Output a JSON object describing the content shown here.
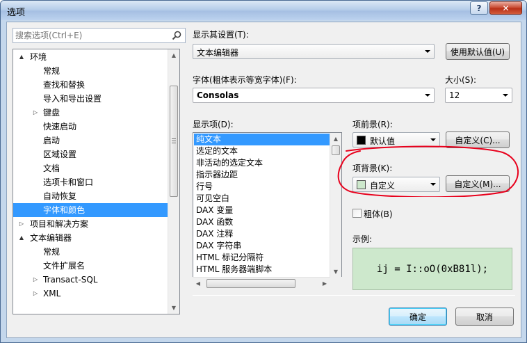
{
  "window": {
    "title": "选项",
    "help_label": "?",
    "close_label": "✕"
  },
  "search": {
    "placeholder": "搜索选项(Ctrl+E)",
    "icon": "search-icon"
  },
  "tree": {
    "items": [
      {
        "label": "环境",
        "arrow": "▲",
        "level": 0
      },
      {
        "label": "常规",
        "arrow": "",
        "level": 1
      },
      {
        "label": "查找和替换",
        "arrow": "",
        "level": 1
      },
      {
        "label": "导入和导出设置",
        "arrow": "",
        "level": 1
      },
      {
        "label": "键盘",
        "arrow": "▷",
        "level": 1
      },
      {
        "label": "快速启动",
        "arrow": "",
        "level": 1
      },
      {
        "label": "启动",
        "arrow": "",
        "level": 1
      },
      {
        "label": "区域设置",
        "arrow": "",
        "level": 1
      },
      {
        "label": "文档",
        "arrow": "",
        "level": 1
      },
      {
        "label": "选项卡和窗口",
        "arrow": "",
        "level": 1
      },
      {
        "label": "自动恢复",
        "arrow": "",
        "level": 1
      },
      {
        "label": "字体和颜色",
        "arrow": "",
        "level": 1,
        "selected": true
      },
      {
        "label": "项目和解决方案",
        "arrow": "▷",
        "level": 0
      },
      {
        "label": "文本编辑器",
        "arrow": "▲",
        "level": 0
      },
      {
        "label": "常规",
        "arrow": "",
        "level": 1
      },
      {
        "label": "文件扩展名",
        "arrow": "",
        "level": 1
      },
      {
        "label": "Transact-SQL",
        "arrow": "▷",
        "level": 1
      },
      {
        "label": "XML",
        "arrow": "▷",
        "level": 1
      }
    ]
  },
  "display_settings": {
    "label": "显示其设置(T):",
    "value": "文本编辑器",
    "use_default_label": "使用默认值(U)"
  },
  "font": {
    "label": "字体(粗体表示等宽字体)(F):",
    "value": "Consolas",
    "size_label": "大小(S):",
    "size_value": "12"
  },
  "display_items": {
    "label": "显示项(D):",
    "items": [
      "纯文本",
      "选定的文本",
      "非活动的选定文本",
      "指示器边距",
      "行号",
      "可见空白",
      "DAX 变量",
      "DAX 函数",
      "DAX 注释",
      "DAX 字符串",
      "HTML 标记分隔符",
      "HTML 服务器端脚本"
    ],
    "selected_index": 0
  },
  "foreground": {
    "label": "项前景(R):",
    "value": "默认值",
    "swatch_color": "#000000",
    "custom_label": "自定义(C)..."
  },
  "background": {
    "label": "项背景(K):",
    "value": "自定义",
    "swatch_color": "#cde8cc",
    "custom_label": "自定义(M)..."
  },
  "bold": {
    "label": "粗体(B)",
    "checked": false
  },
  "sample": {
    "label": "示例:",
    "text": "ij = I::oO(0xB81l);",
    "background": "#cde8cc"
  },
  "buttons": {
    "ok_label": "确定",
    "cancel_label": "取消"
  },
  "annotation_color": "#e8001c"
}
